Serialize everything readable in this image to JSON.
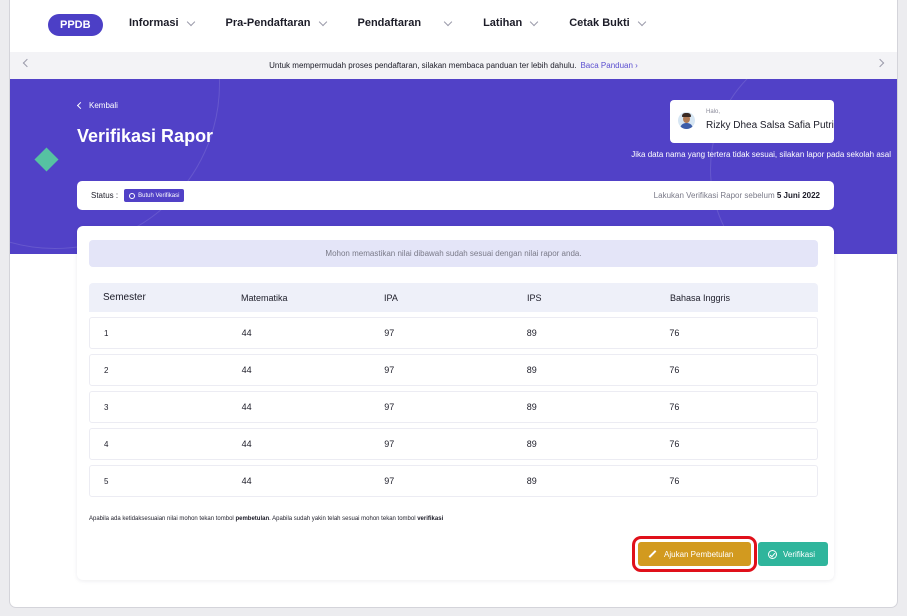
{
  "nav": {
    "logo": "PPDB",
    "menu": [
      {
        "label": "Informasi"
      },
      {
        "label": "Pra-Pendaftaran"
      },
      {
        "label": "Pendaftaran"
      },
      {
        "label": "Latihan"
      },
      {
        "label": "Cetak Bukti"
      }
    ]
  },
  "notice": {
    "text": "Untuk mempermudah proses pendaftaran, silakan membaca panduan ter lebih dahulu.",
    "link": "Baca Panduan ›"
  },
  "hero": {
    "back": "Kembali",
    "title": "Verifikasi Rapor",
    "greeting_hi": "Halo,",
    "user_name": "Rizky Dhea Salsa Safia Putri",
    "note": "Jika data nama yang tertera tidak sesuai, silakan lapor pada sekolah asal"
  },
  "status": {
    "label": "Status :",
    "badge": "Butuh Verifikasi",
    "deadline_prefix": "Lakukan Verifikasi Rapor sebelum",
    "deadline_date": "5 Juni 2022"
  },
  "card": {
    "info": "Mohon memastikan nilai dibawah sudah sesuai dengan nilai rapor anda.",
    "headers": [
      "Semester",
      "Matematika",
      "IPA",
      "IPS",
      "Bahasa Inggris"
    ],
    "rows": [
      [
        "1",
        "44",
        "97",
        "89",
        "76"
      ],
      [
        "2",
        "44",
        "97",
        "89",
        "76"
      ],
      [
        "3",
        "44",
        "97",
        "89",
        "76"
      ],
      [
        "4",
        "44",
        "97",
        "89",
        "76"
      ],
      [
        "5",
        "44",
        "97",
        "89",
        "76"
      ]
    ],
    "footnote_a": "Apabila ada ketidaksesuaian nilai mohon tekan tombol ",
    "footnote_b": "pembetulan",
    "footnote_c": ". Apabila sudah yakin telah sesuai mohon tekan tombol ",
    "footnote_d": "verifikasi",
    "btn_fix": "Ajukan Pembetulan",
    "btn_verify": "Verifikasi"
  },
  "colors": {
    "primary": "#5141c7",
    "accent_green": "#2fb59c",
    "warning": "#d29a1f",
    "highlight_box": "#e0101a"
  }
}
